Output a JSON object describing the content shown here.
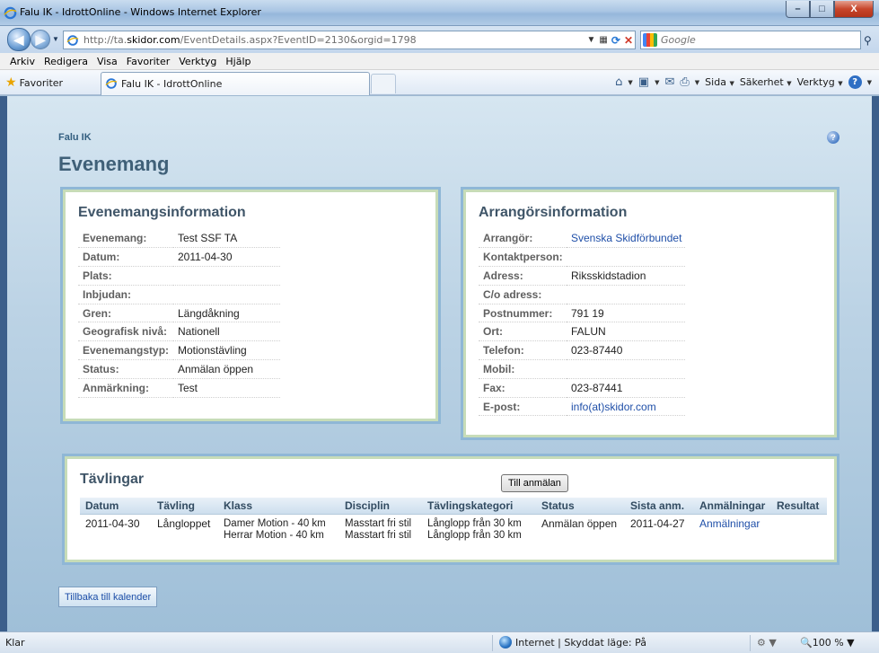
{
  "window": {
    "title": "Falu IK - IdrottOnline - Windows Internet Explorer",
    "controls": {
      "minimize": "–",
      "maximize": "□",
      "close": "X"
    }
  },
  "address_bar": {
    "url_prefix": "http://ta.",
    "url_domain": "skidor.com",
    "url_path": "/EventDetails.aspx?EventID=2130&orgid=1798",
    "search_placeholder": "Google",
    "search_icon": "search-icon"
  },
  "menu": [
    "Arkiv",
    "Redigera",
    "Visa",
    "Favoriter",
    "Verktyg",
    "Hjälp"
  ],
  "favorites_bar": {
    "favorites_label": "Favoriter",
    "tab_title": "Falu IK - IdrottOnline",
    "commands": {
      "page": "Sida",
      "safety": "Säkerhet",
      "tools": "Verktyg"
    }
  },
  "page": {
    "org_name": "Falu IK",
    "title": "Evenemang",
    "event_info": {
      "heading": "Evenemangsinformation",
      "rows": [
        {
          "label": "Evenemang:",
          "value": "Test SSF TA"
        },
        {
          "label": "Datum:",
          "value": "2011-04-30"
        },
        {
          "label": "Plats:",
          "value": ""
        },
        {
          "label": "Inbjudan:",
          "value": ""
        },
        {
          "label": "Gren:",
          "value": "Längdåkning"
        },
        {
          "label": "Geografisk nivå:",
          "value": "Nationell"
        },
        {
          "label": "Evenemangstyp:",
          "value": "Motionstävling"
        },
        {
          "label": "Status:",
          "value": "Anmälan öppen"
        },
        {
          "label": "Anmärkning:",
          "value": "Test"
        }
      ]
    },
    "organizer_info": {
      "heading": "Arrangörsinformation",
      "rows": [
        {
          "label": "Arrangör:",
          "value": "Svenska Skidförbundet",
          "link": true
        },
        {
          "label": "Kontaktperson:",
          "value": ""
        },
        {
          "label": "Adress:",
          "value": "Riksskidstadion"
        },
        {
          "label": "C/o adress:",
          "value": ""
        },
        {
          "label": "Postnummer:",
          "value": "791 19"
        },
        {
          "label": "Ort:",
          "value": "FALUN"
        },
        {
          "label": "Telefon:",
          "value": "023-87440"
        },
        {
          "label": "Mobil:",
          "value": ""
        },
        {
          "label": "Fax:",
          "value": "023-87441"
        },
        {
          "label": "E-post:",
          "value": "info(at)skidor.com",
          "link": true
        }
      ]
    },
    "competitions": {
      "heading": "Tävlingar",
      "register_button": "Till anmälan",
      "columns": [
        "Datum",
        "Tävling",
        "Klass",
        "Disciplin",
        "Tävlingskategori",
        "Status",
        "Sista anm.",
        "Anmälningar",
        "Resultat"
      ],
      "rows": [
        {
          "date": "2011-04-30",
          "competition": "Långloppet",
          "class_lines": [
            "Damer Motion - 40 km",
            "Herrar Motion - 40 km"
          ],
          "discipline_lines": [
            "Masstart fri stil",
            "Masstart fri stil"
          ],
          "category_lines": [
            "Långlopp från 30 km",
            "Långlopp från 30 km"
          ],
          "status": "Anmälan öppen",
          "last_reg": "2011-04-27",
          "registrations": "Anmälningar",
          "result": ""
        }
      ]
    },
    "back_button": "Tillbaka till kalender"
  },
  "status_bar": {
    "status": "Klar",
    "zone": "Internet | Skyddat läge: På",
    "zoom": "100 %"
  }
}
